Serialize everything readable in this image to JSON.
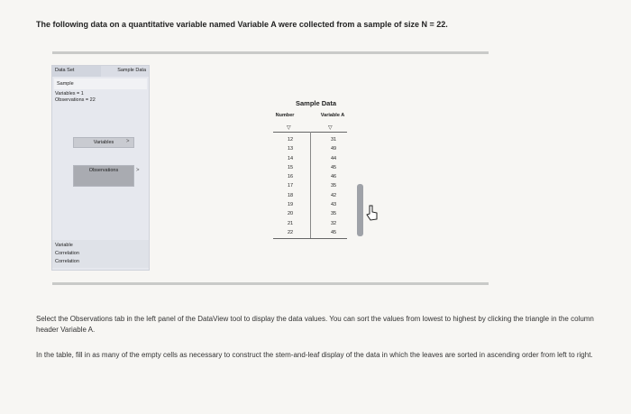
{
  "intro": "The following data on a quantitative variable named Variable A were collected from a sample of size N = 22.",
  "left_panel": {
    "tabs": [
      "Data Set",
      "Sample Data"
    ],
    "sample_label": "Sample",
    "variables_line": "Variables = 1",
    "observations_line": "Observations = 22",
    "variables_button": "Variables",
    "observations_button": "Observations",
    "arrow": ">",
    "links": [
      "Variable",
      "Correlation",
      "Correlation"
    ]
  },
  "data_view": {
    "title": "Sample Data",
    "col_number": "Number",
    "col_variable": "Variable A",
    "sort_glyph": "▽",
    "numbers": [
      "12",
      "13",
      "14",
      "15",
      "16",
      "17",
      "18",
      "19",
      "20",
      "21",
      "22"
    ],
    "values": [
      "31",
      "49",
      "44",
      "45",
      "46",
      "35",
      "42",
      "43",
      "35",
      "32",
      "45"
    ]
  },
  "instructions": {
    "one": "Select the Observations tab in the left panel of the DataView tool to display the data values. You can sort the values from lowest to highest by clicking the triangle in the column header Variable A.",
    "two": "In the table, fill in as many of the empty cells as necessary to construct the stem-and-leaf display of the data in which the leaves are sorted in ascending order from left to right."
  }
}
